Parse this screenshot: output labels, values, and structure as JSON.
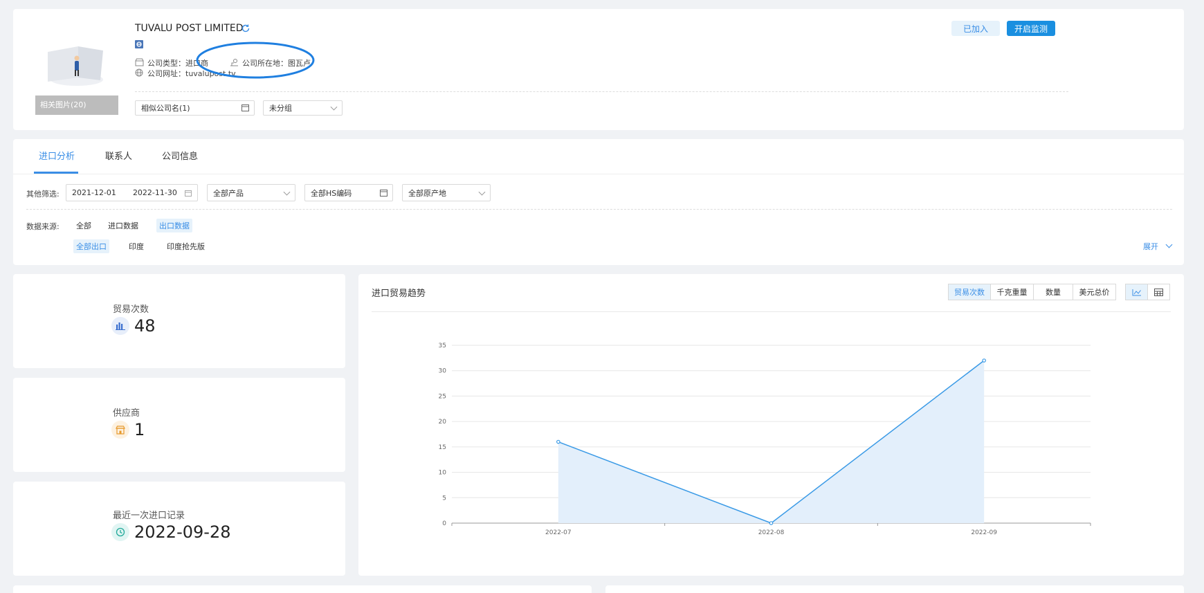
{
  "company": {
    "name": "TUVALU POST LIMITED",
    "type_label": "公司类型：进口商",
    "location_label": "公司所在地：图瓦卢",
    "website_label": "公司网址：tuvalupost.tv",
    "photos_label": "相关图片(20)",
    "similar_names": "相似公司名(1)",
    "group": "未分组"
  },
  "actions": {
    "joined": "已加入",
    "monitor": "开启监测"
  },
  "tabs": [
    {
      "label": "进口分析"
    },
    {
      "label": "联系人"
    },
    {
      "label": "公司信息"
    }
  ],
  "filters": {
    "label": "其他筛选:",
    "date_start": "2021-12-01",
    "date_end": "2022-11-30",
    "product": "全部产品",
    "hs_code": "全部HS编码",
    "origin": "全部原产地"
  },
  "source": {
    "label": "数据来源:",
    "options": [
      "全部",
      "进口数据",
      "出口数据"
    ],
    "sub_options": [
      "全部出口",
      "印度",
      "印度抢先版"
    ],
    "expand": "展开"
  },
  "stats": [
    {
      "label": "贸易次数",
      "value": "48",
      "icon": "bar-chart-icon"
    },
    {
      "label": "供应商",
      "value": "1",
      "icon": "store-icon"
    },
    {
      "label": "最近一次进口记录",
      "value": "2022-09-28",
      "icon": "clock-icon"
    }
  ],
  "trend": {
    "title": "进口贸易趋势",
    "metrics": [
      "贸易次数",
      "千克重量",
      "数量",
      "美元总价"
    ]
  },
  "colors": {
    "accent": "#3a8ee6",
    "primary_button": "#1a8fe0",
    "annotation_ellipse": "#1f7fe0"
  },
  "chart_data": {
    "type": "area",
    "categories": [
      "2022-07",
      "2022-08",
      "2022-09"
    ],
    "series": [
      {
        "values": [
          16,
          0,
          32
        ]
      }
    ],
    "ylim": [
      0,
      35
    ],
    "yticks": [
      0,
      5,
      10,
      15,
      20,
      25,
      30,
      35
    ],
    "grid": true
  }
}
